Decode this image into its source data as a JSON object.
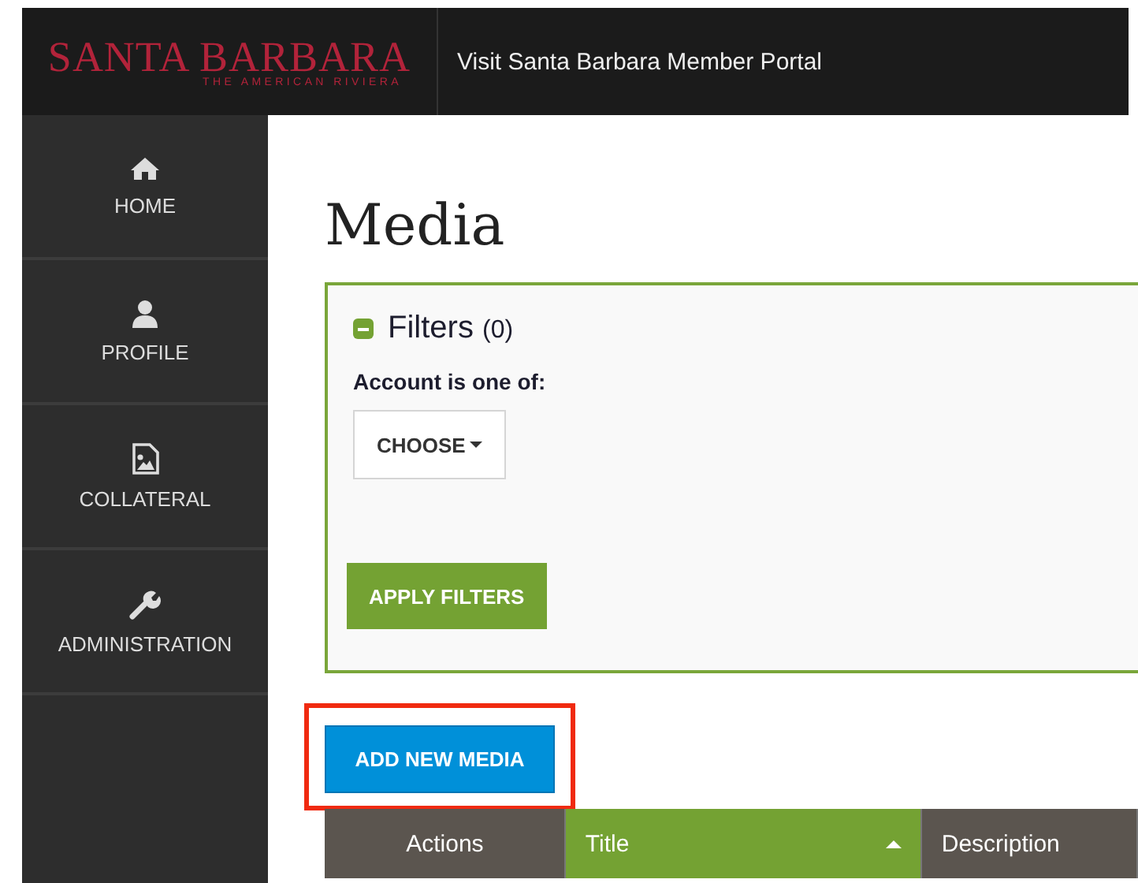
{
  "header": {
    "logo": "SANTA BARBARA",
    "logo_tagline": "THE AMERICAN RIVIERA",
    "title": "Visit Santa Barbara Member Portal"
  },
  "sidebar": {
    "items": [
      {
        "label": "HOME",
        "selected": false
      },
      {
        "label": "PROFILE",
        "selected": false
      },
      {
        "label": "COLLATERAL",
        "selected": false
      },
      {
        "label": "ADMINISTRATION",
        "selected": false
      }
    ]
  },
  "page_title": "Media",
  "filters": {
    "title": "Filters",
    "count": "(0)",
    "expanded": true,
    "field_label": "Account is one of:",
    "dropdown": "CHOOSE",
    "apply_button": "APPLY FILTERS"
  },
  "add_button": {
    "label": "ADD NEW MEDIA",
    "highlighted": true
  },
  "table": {
    "columns": [
      {
        "label": "Actions",
        "sorted": false
      },
      {
        "label": "Title",
        "sorted": true
      },
      {
        "label": "Description",
        "sorted": false
      }
    ]
  }
}
